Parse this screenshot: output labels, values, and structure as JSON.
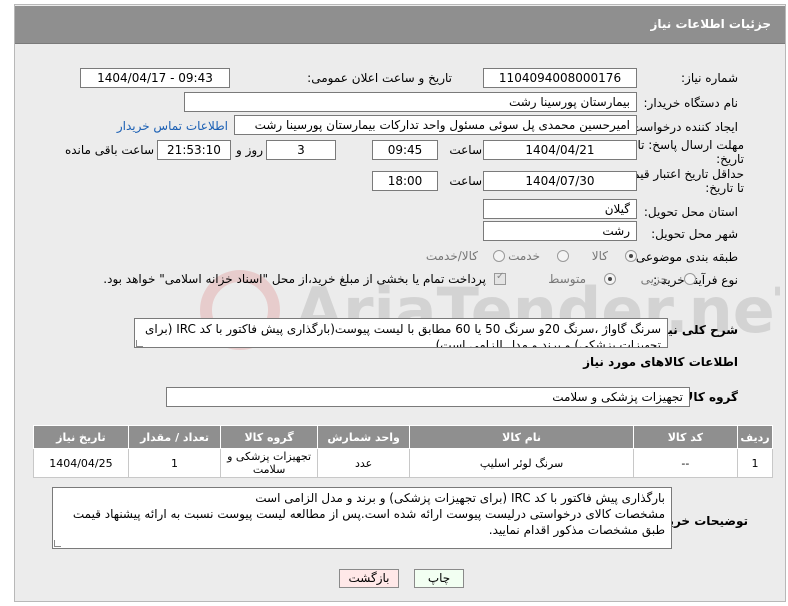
{
  "header": {
    "title": "جزئیات اطلاعات نیاز"
  },
  "fields": {
    "need_number_label": "شماره نیاز:",
    "need_number": "1104094008000176",
    "announce_label": "تاریخ و ساعت اعلان عمومی:",
    "announce_value": "1404/04/17 - 09:43",
    "buyer_org_label": "نام دستگاه خریدار:",
    "buyer_org": "بیمارستان پورسینا رشت",
    "creator_label": "ایجاد کننده درخواست:",
    "creator": "امیرحسین محمدی پل سوئی مسئول واحد تدارکات بیمارستان پورسینا رشت",
    "contact_link": "اطلاعات تماس خریدار",
    "deadline_label_1": "مهلت ارسال پاسخ: تا",
    "deadline_label_2": "تاریخ:",
    "deadline_date": "1404/04/21",
    "time_label": "ساعت",
    "deadline_time": "09:45",
    "days": "3",
    "days_label": "روز و",
    "remaining_time": "21:53:10",
    "remaining_label": "ساعت باقی مانده",
    "validity_label_1": "حداقل تاریخ اعتبار قیمت:",
    "validity_label_2": "تا تاریخ:",
    "validity_date": "1404/07/30",
    "validity_time": "18:00",
    "province_label": "استان محل تحویل:",
    "province": "گیلان",
    "city_label": "شهر محل تحویل:",
    "city": "رشت",
    "category_label": "طبقه بندی موضوعی:",
    "category_options": [
      "کالا",
      "خدمت",
      "کالا/خدمت"
    ],
    "category_selected": "کالا",
    "process_label": "نوع فرآیند خرید :",
    "process_options": [
      "جزیی",
      "متوسط"
    ],
    "process_selected": "متوسط",
    "payment_note": "پرداخت تمام یا بخشی از مبلغ خرید،از محل \"اسناد خزانه اسلامی\" خواهد بود."
  },
  "description": {
    "label": "شرح کلی نیاز:",
    "text": "سرنگ گاواژ ،سرنگ 20و سرنگ 50 یا 60 مطابق با لیست پیوست(بارگذاری پیش فاکتور با کد IRC (برای تجهیزات پزشکی) و برند و مدل الزامی است)"
  },
  "goods": {
    "section_title": "اطلاعات کالاهای مورد نیاز",
    "group_label": "گروه کالا:",
    "group_value": "تجهیزات پزشکی و سلامت",
    "columns": [
      "ردیف",
      "کد کالا",
      "نام کالا",
      "واحد شمارش",
      "گروه کالا",
      "تعداد / مقدار",
      "تاریخ نیاز"
    ],
    "rows": [
      {
        "row": "1",
        "code": "--",
        "name": "سرنگ لوئر اسلیپ",
        "unit": "عدد",
        "group": "تجهیزات پزشکی و سلامت",
        "qty": "1",
        "date": "1404/04/25"
      }
    ]
  },
  "buyer_notes": {
    "label": "توضیحات خریدار:",
    "lines": [
      "بارگذاری پیش فاکتور با کد IRC (برای تجهیزات پزشکی) و برند و مدل الزامی است",
      "مشخصات کالای درخواستی درلیست پیوست ارائه شده است.پس از مطالعه لیست پیوست نسبت به ارائه پیشنهاد قیمت",
      "طبق مشخصات مذکور اقدام نمایید."
    ]
  },
  "buttons": {
    "print": "چاپ",
    "back": "بازگشت"
  },
  "watermark": {
    "text": "AriaTender.neT"
  }
}
